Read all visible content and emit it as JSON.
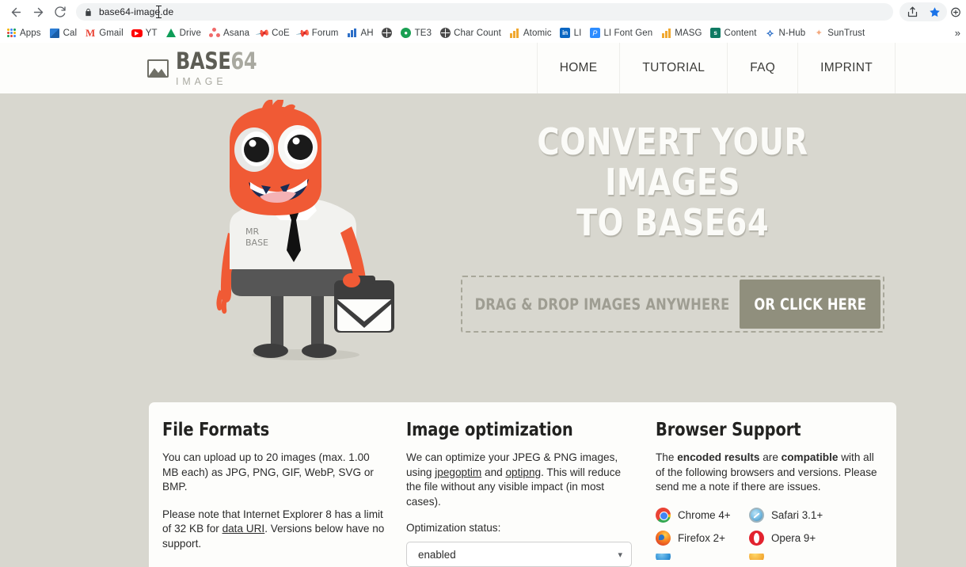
{
  "browser": {
    "url": "base64-image.de",
    "lock_icon": "lock-icon",
    "back_icon": "back-arrow-icon",
    "forward_icon": "forward-arrow-icon",
    "reload_icon": "reload-icon",
    "share_icon": "share-icon",
    "bookmark_star_icon": "star-icon",
    "profile_icon": "profile-icon",
    "overflow_label": "»",
    "bookmarks": [
      {
        "label": "Apps",
        "icon": "apps-grid-icon"
      },
      {
        "label": "Cal",
        "icon": "calendar-icon"
      },
      {
        "label": "Gmail",
        "icon": "gmail-icon"
      },
      {
        "label": "YT",
        "icon": "youtube-icon"
      },
      {
        "label": "Drive",
        "icon": "google-drive-icon"
      },
      {
        "label": "Asana",
        "icon": "asana-icon"
      },
      {
        "label": "CoE",
        "icon": "pin-icon"
      },
      {
        "label": "Forum",
        "icon": "pin-icon"
      },
      {
        "label": "AH",
        "icon": "bar-chart-icon"
      },
      {
        "label": "",
        "icon": "globe-icon"
      },
      {
        "label": "TE3",
        "icon": "te3-icon"
      },
      {
        "label": "Char Count",
        "icon": "globe-icon"
      },
      {
        "label": "Atomic",
        "icon": "bar-chart-orange-icon"
      },
      {
        "label": "LI",
        "icon": "linkedin-icon"
      },
      {
        "label": "LI Font Gen",
        "icon": "font-gen-icon"
      },
      {
        "label": "MASG",
        "icon": "bar-chart-orange-icon"
      },
      {
        "label": "Content",
        "icon": "sharepoint-icon"
      },
      {
        "label": "N-Hub",
        "icon": "n-hub-icon"
      },
      {
        "label": "SunTrust",
        "icon": "suntrust-icon"
      }
    ]
  },
  "site": {
    "logo": {
      "mark_icon": "image-placeholder-icon",
      "title_dark": "BASE",
      "title_light": "64",
      "subtitle": "IMAGE"
    },
    "nav": [
      {
        "label": "HOME",
        "active": true
      },
      {
        "label": "TUTORIAL",
        "active": false
      },
      {
        "label": "FAQ",
        "active": false
      },
      {
        "label": "IMPRINT",
        "active": false
      }
    ]
  },
  "hero": {
    "title_line1": "CONVERT YOUR IMAGES",
    "title_line2": "TO BASE64",
    "mascot": {
      "name": "mr-base-mascot",
      "shirt_text_line1": "MR",
      "shirt_text_line2": "BASE"
    },
    "arrow_icon": "curved-arrow-icon",
    "dropzone": {
      "text": "DRAG & DROP IMAGES ANYWHERE",
      "button_label": "OR CLICK HERE"
    }
  },
  "cards": {
    "file_formats": {
      "heading": "File Formats",
      "p1_a": "You can upload up to 20 images (max. 1.00 MB each) as JPG, PNG, GIF, WebP, SVG or BMP.",
      "p2_a": "Please note that Internet Explorer 8 has a limit of 32 KB for ",
      "p2_link": "data URI",
      "p2_b": ". Versions below have no support."
    },
    "image_optimization": {
      "heading": "Image optimization",
      "p1_a": "We can optimize your JPEG & PNG images, using ",
      "link1": "jpegoptim",
      "p1_b": " and ",
      "link2": "optipng",
      "p1_c": ". This will reduce the file without any visible impact (in most cases).",
      "status_label": "Optimization status:",
      "status_value": "enabled",
      "chevron_icon": "chevron-down-icon"
    },
    "browser_support": {
      "heading": "Browser Support",
      "p1_a": "The ",
      "p1_b1": "encoded results",
      "p1_c": " are ",
      "p1_b2": "compatible",
      "p1_d": " with all of the following browsers and versions. Please send me a note if there are issues.",
      "browsers": [
        {
          "label": "Chrome 4+",
          "icon": "chrome-icon"
        },
        {
          "label": "Safari 3.1+",
          "icon": "safari-icon"
        },
        {
          "label": "Firefox 2+",
          "icon": "firefox-icon"
        },
        {
          "label": "Opera 9+",
          "icon": "opera-icon"
        }
      ]
    }
  },
  "colors": {
    "hero_bg": "#d8d7cf",
    "card_bg": "#fdfdfb",
    "button_olive": "#908f7d",
    "mascot_orange": "#f05a35",
    "accent_blue": "#1a73e8"
  }
}
